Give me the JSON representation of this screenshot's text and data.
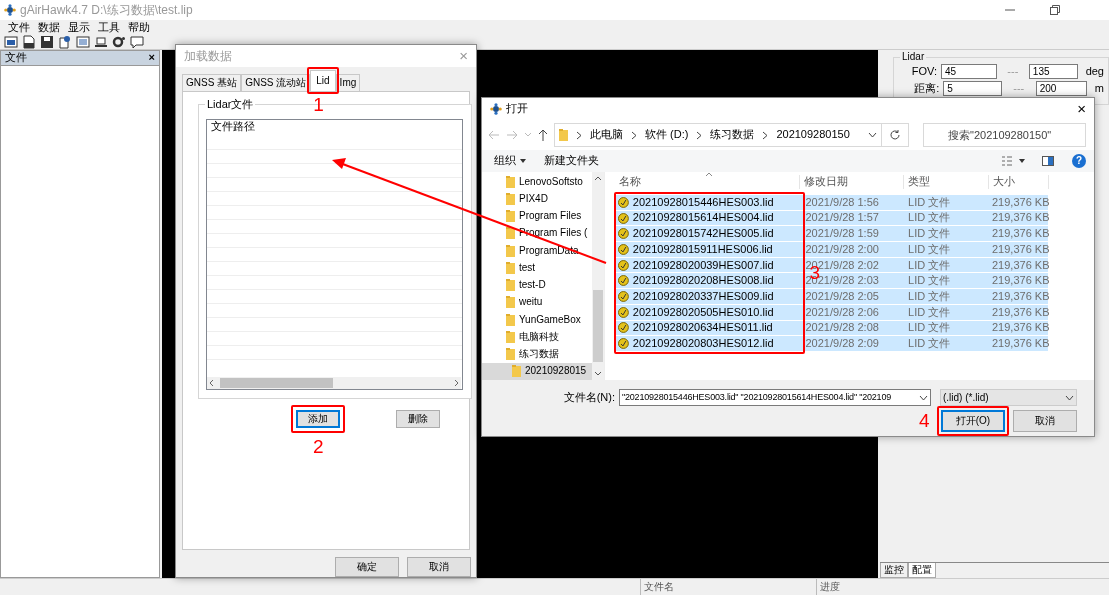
{
  "window": {
    "title": "gAirHawk4.7 D:\\练习数据\\test.lip"
  },
  "menu": [
    "文件",
    "数据",
    "显示",
    "工具",
    "帮助"
  ],
  "file_panel": {
    "title": "文件",
    "close": "×"
  },
  "lidar_panel": {
    "title": "Lidar",
    "rows": [
      {
        "label": "FOV:",
        "min": "45",
        "separator": "---",
        "max": "135",
        "unit": "deg"
      },
      {
        "label": "距离:",
        "min": "5",
        "separator": "---",
        "max": "200",
        "unit": "m"
      }
    ]
  },
  "panel_tabs": [
    {
      "label": "监控",
      "selected": false
    },
    {
      "label": "配置",
      "selected": true
    }
  ],
  "status_bar": [
    "文件名",
    "进度"
  ],
  "load_dialog": {
    "title": "加载数据",
    "close": "×",
    "tabs": [
      {
        "label": "GNSS 基站",
        "selected": false
      },
      {
        "label": "GNSS 流动站",
        "selected": false
      },
      {
        "label": "Lid",
        "selected": true
      },
      {
        "label": "Img",
        "selected": false
      }
    ],
    "group": "Lidar文件",
    "list_header": "文件路径",
    "buttons": [
      {
        "label": "添加",
        "focused": true
      },
      {
        "label": "删除",
        "focused": false
      }
    ],
    "footer": [
      "确定",
      "取消"
    ]
  },
  "open_dialog": {
    "title": "打开",
    "close": "×",
    "breadcrumb": [
      "此电脑",
      "软件 (D:)",
      "练习数据",
      "202109280150"
    ],
    "search": {
      "placeholder": "搜索\"202109280150\""
    },
    "toolbar": [
      "组织",
      "新建文件夹"
    ],
    "help": "?",
    "tree": [
      {
        "label": "LenovoSoftsto",
        "selected": false
      },
      {
        "label": "PIX4D",
        "selected": false
      },
      {
        "label": "Program Files",
        "selected": false
      },
      {
        "label": "Program Files (",
        "selected": false
      },
      {
        "label": "ProgramData",
        "selected": false
      },
      {
        "label": "test",
        "selected": false
      },
      {
        "label": "test-D",
        "selected": false
      },
      {
        "label": "weitu",
        "selected": false
      },
      {
        "label": "YunGameBox",
        "selected": false
      },
      {
        "label": "电脑科技",
        "selected": false
      },
      {
        "label": "练习数据",
        "selected": false,
        "children": [
          {
            "label": "20210928015",
            "selected": true
          }
        ]
      }
    ],
    "columns": [
      "名称",
      "修改日期",
      "类型",
      "大小"
    ],
    "files": [
      {
        "name": "20210928015446HES003.lid",
        "date": "2021/9/28 1:56",
        "type": "LID 文件",
        "size": "219,376 KB",
        "selected": true
      },
      {
        "name": "20210928015614HES004.lid",
        "date": "2021/9/28 1:57",
        "type": "LID 文件",
        "size": "219,376 KB",
        "selected": true
      },
      {
        "name": "20210928015742HES005.lid",
        "date": "2021/9/28 1:59",
        "type": "LID 文件",
        "size": "219,376 KB",
        "selected": true
      },
      {
        "name": "20210928015911HES006.lid",
        "date": "2021/9/28 2:00",
        "type": "LID 文件",
        "size": "219,376 KB",
        "selected": true
      },
      {
        "name": "20210928020039HES007.lid",
        "date": "2021/9/28 2:02",
        "type": "LID 文件",
        "size": "219,376 KB",
        "selected": true
      },
      {
        "name": "20210928020208HES008.lid",
        "date": "2021/9/28 2:03",
        "type": "LID 文件",
        "size": "219,376 KB",
        "selected": true
      },
      {
        "name": "20210928020337HES009.lid",
        "date": "2021/9/28 2:05",
        "type": "LID 文件",
        "size": "219,376 KB",
        "selected": true
      },
      {
        "name": "20210928020505HES010.lid",
        "date": "2021/9/28 2:06",
        "type": "LID 文件",
        "size": "219,376 KB",
        "selected": true
      },
      {
        "name": "20210928020634HES011.lid",
        "date": "2021/9/28 2:08",
        "type": "LID 文件",
        "size": "219,376 KB",
        "selected": true
      },
      {
        "name": "20210928020803HES012.lid",
        "date": "2021/9/28 2:09",
        "type": "LID 文件",
        "size": "219,376 KB",
        "selected": true
      }
    ],
    "filename_label": "文件名(N):",
    "filename_value": "\"20210928015446HES003.lid\" \"20210928015614HES004.lid\" \"202109",
    "filter": "(.lid) (*.lid)",
    "buttons": [
      {
        "label": "打开(O)",
        "focused": true
      },
      {
        "label": "取消",
        "focused": false
      }
    ]
  },
  "annotations": [
    {
      "label": "1"
    },
    {
      "label": "2"
    },
    {
      "label": "3"
    },
    {
      "label": "4"
    }
  ]
}
